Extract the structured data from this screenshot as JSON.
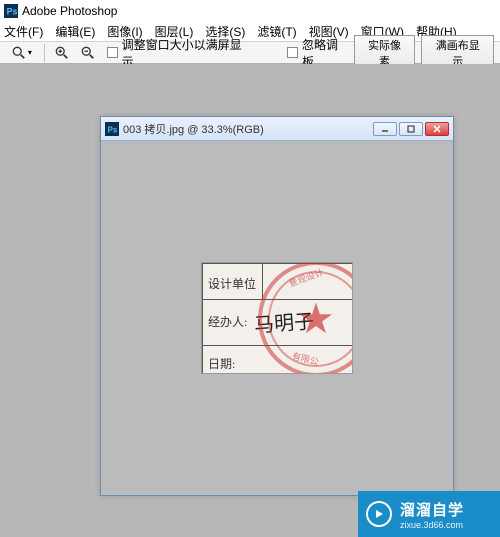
{
  "app": {
    "title": "Adobe Photoshop"
  },
  "menu": {
    "file": "文件(F)",
    "edit": "编辑(E)",
    "image": "图像(I)",
    "layer": "图层(L)",
    "select": "选择(S)",
    "filter": "滤镜(T)",
    "view": "视图(V)",
    "window": "窗口(W)",
    "help": "帮助(H)"
  },
  "toolbar": {
    "fit_window": "调整窗口大小以满屏显示",
    "ignore_palettes": "忽略调板",
    "actual_pixels": "实际像素",
    "fit_screen": "满画布显示"
  },
  "document": {
    "title": "003 拷贝.jpg @ 33.3%(RGB)"
  },
  "form": {
    "design_unit": "设计单位",
    "handler": "经办人:",
    "date": "日期:",
    "signature": "马明子"
  },
  "watermark": {
    "brand": "溜溜自学",
    "url": "zixue.3d66.com"
  }
}
